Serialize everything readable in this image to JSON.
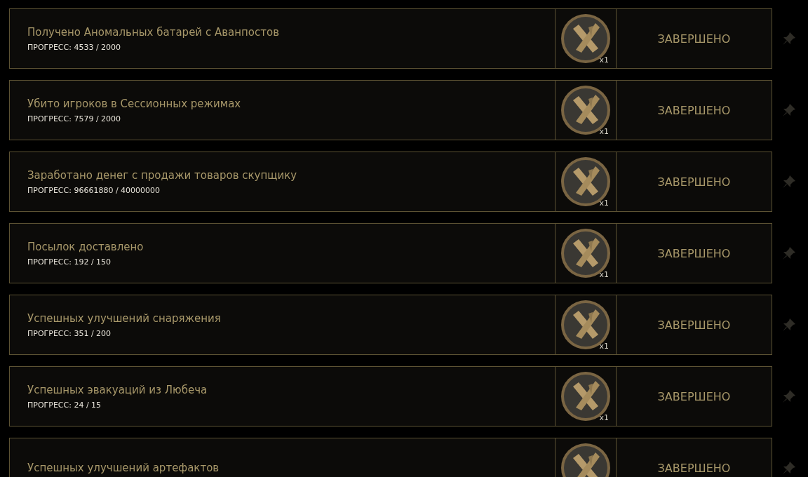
{
  "tasks": [
    {
      "title": "Получено Аномальных батарей с Аванпостов",
      "progress": "ПРОГРЕСС: 4533 / 2000",
      "reward_count": "x1",
      "status": "ЗАВЕРШЕНО"
    },
    {
      "title": "Убито игроков в Сессионных режимах",
      "progress": "ПРОГРЕСС: 7579 / 2000",
      "reward_count": "x1",
      "status": "ЗАВЕРШЕНО"
    },
    {
      "title": "Заработано денег с продажи товаров скупщику",
      "progress": "ПРОГРЕСС: 96661880 / 40000000",
      "reward_count": "x1",
      "status": "ЗАВЕРШЕНО"
    },
    {
      "title": "Посылок доставлено",
      "progress": "ПРОГРЕСС: 192 / 150",
      "reward_count": "x1",
      "status": "ЗАВЕРШЕНО"
    },
    {
      "title": "Успешных улучшений снаряжения",
      "progress": "ПРОГРЕСС: 351 / 200",
      "reward_count": "x1",
      "status": "ЗАВЕРШЕНО"
    },
    {
      "title": "Успешных эвакуаций из Любеча",
      "progress": "ПРОГРЕСС: 24 / 15",
      "reward_count": "x1",
      "status": "ЗАВЕРШЕНО"
    },
    {
      "title": "Успешных улучшений артефактов",
      "status": "ЗАВЕРШЕНО"
    }
  ]
}
